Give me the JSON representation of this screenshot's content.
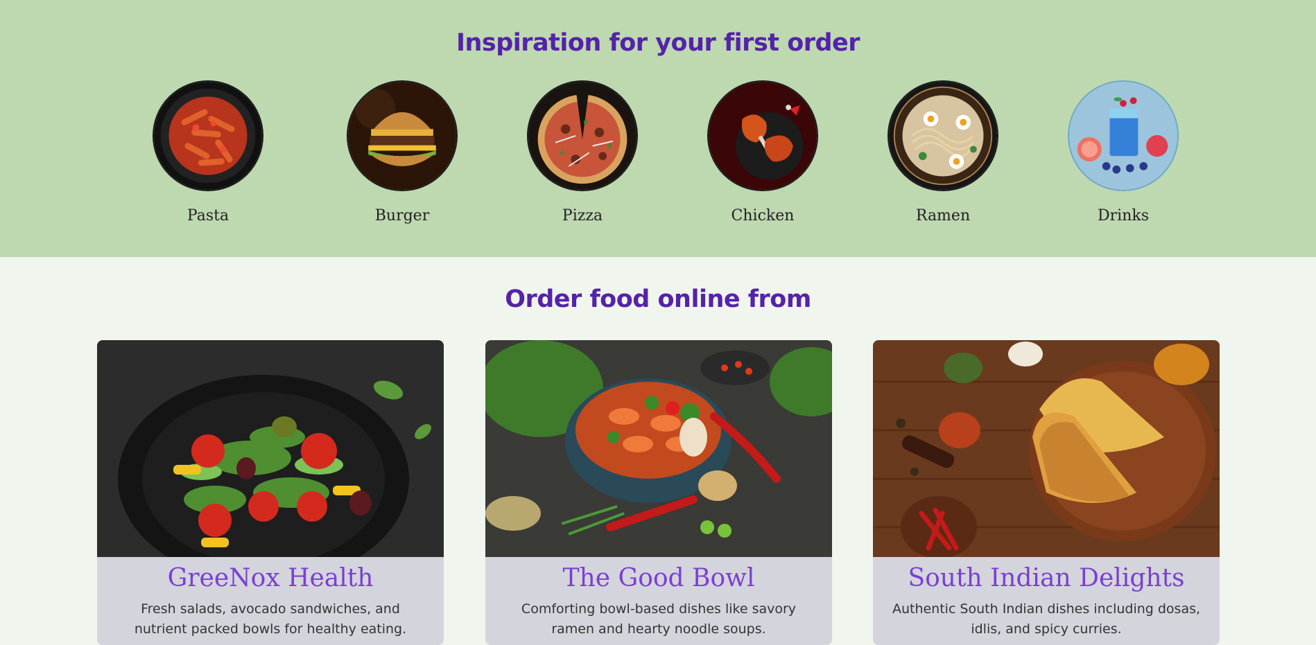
{
  "inspiration": {
    "title": "Inspiration for your first order",
    "categories": [
      {
        "label": "Pasta"
      },
      {
        "label": "Burger"
      },
      {
        "label": "Pizza"
      },
      {
        "label": "Chicken"
      },
      {
        "label": "Ramen"
      },
      {
        "label": "Drinks"
      }
    ]
  },
  "restaurants": {
    "title": "Order food online from",
    "cards": [
      {
        "name": "GreeNox Health",
        "description": "Fresh salads, avocado sandwiches, and nutrient packed bowls for healthy eating."
      },
      {
        "name": "The Good Bowl",
        "description": "Comforting bowl-based dishes like savory ramen and hearty noodle soups."
      },
      {
        "name": "South Indian Delights",
        "description": "Authentic South Indian dishes including dosas, idlis, and spicy curries."
      }
    ]
  },
  "colors": {
    "top_band": "#bed8b0",
    "page_bg": "#f0f5ee",
    "heading": "#5522aa",
    "card_title": "#7a3fd6",
    "card_body": "#d4d5dc"
  }
}
